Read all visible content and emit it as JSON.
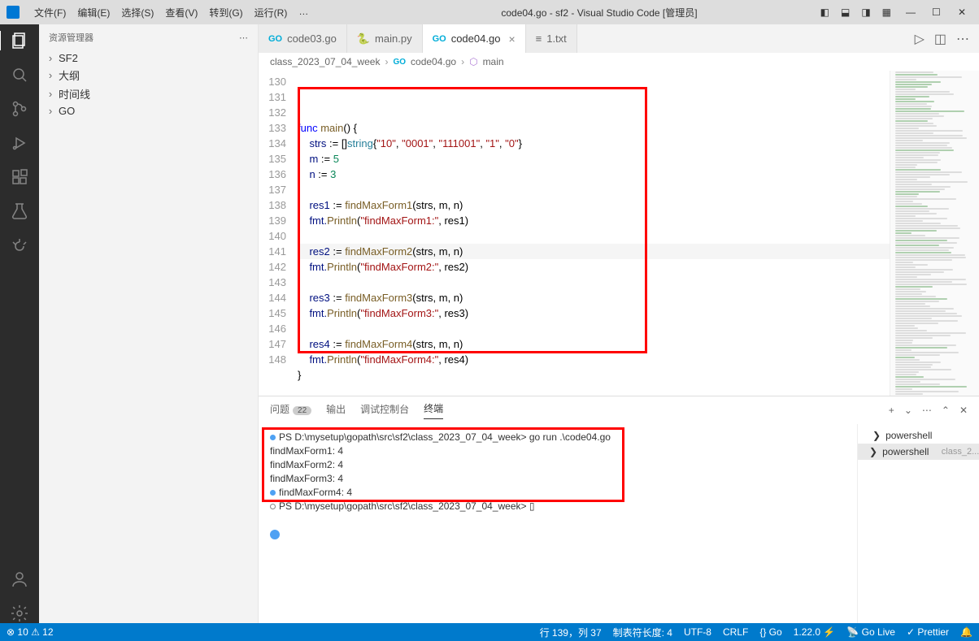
{
  "title": "code04.go - sf2 - Visual Studio Code [管理员]",
  "menu": [
    "文件(F)",
    "编辑(E)",
    "选择(S)",
    "查看(V)",
    "转到(G)",
    "运行(R)",
    "…"
  ],
  "sidebar": {
    "header": "资源管理器",
    "items": [
      "SF2",
      "大纲",
      "时间线",
      "GO"
    ]
  },
  "tabs": [
    {
      "icon": "go",
      "label": "code03.go",
      "active": false,
      "close": false
    },
    {
      "icon": "py",
      "label": "main.py",
      "active": false,
      "close": false
    },
    {
      "icon": "go",
      "label": "code04.go",
      "active": true,
      "close": true
    },
    {
      "icon": "txt",
      "label": "1.txt",
      "active": false,
      "close": false
    }
  ],
  "breadcrumbs": [
    "class_2023_07_04_week",
    "code04.go",
    "main"
  ],
  "lines": [
    130,
    131,
    132,
    133,
    134,
    135,
    136,
    137,
    138,
    139,
    140,
    141,
    142,
    143,
    144,
    145,
    146,
    147,
    148
  ],
  "code": {
    "131": [
      {
        "t": "func ",
        "c": "kw"
      },
      {
        "t": "main",
        "c": "fn"
      },
      {
        "t": "() {",
        "c": "op"
      }
    ],
    "132": [
      {
        "t": "    strs ",
        "c": "var"
      },
      {
        "t": ":= []",
        "c": "op"
      },
      {
        "t": "string",
        "c": "type"
      },
      {
        "t": "{",
        "c": "op"
      },
      {
        "t": "\"10\"",
        "c": "str"
      },
      {
        "t": ", ",
        "c": "op"
      },
      {
        "t": "\"0001\"",
        "c": "str"
      },
      {
        "t": ", ",
        "c": "op"
      },
      {
        "t": "\"111001\"",
        "c": "str"
      },
      {
        "t": ", ",
        "c": "op"
      },
      {
        "t": "\"1\"",
        "c": "str"
      },
      {
        "t": ", ",
        "c": "op"
      },
      {
        "t": "\"0\"",
        "c": "str"
      },
      {
        "t": "}",
        "c": "op"
      }
    ],
    "133": [
      {
        "t": "    m ",
        "c": "var"
      },
      {
        "t": ":= ",
        "c": "op"
      },
      {
        "t": "5",
        "c": "num"
      }
    ],
    "134": [
      {
        "t": "    n ",
        "c": "var"
      },
      {
        "t": ":= ",
        "c": "op"
      },
      {
        "t": "3",
        "c": "num"
      }
    ],
    "135": [],
    "136": [
      {
        "t": "    res1 ",
        "c": "var"
      },
      {
        "t": ":= ",
        "c": "op"
      },
      {
        "t": "findMaxForm1",
        "c": "fn"
      },
      {
        "t": "(strs, m, n)",
        "c": "op"
      }
    ],
    "137": [
      {
        "t": "    fmt.",
        "c": "var"
      },
      {
        "t": "Println",
        "c": "fn"
      },
      {
        "t": "(",
        "c": "op"
      },
      {
        "t": "\"findMaxForm1:\"",
        "c": "str"
      },
      {
        "t": ", res1)",
        "c": "op"
      }
    ],
    "138": [],
    "139": [
      {
        "t": "    res2 ",
        "c": "var"
      },
      {
        "t": ":= ",
        "c": "op"
      },
      {
        "t": "findMaxForm2",
        "c": "fn"
      },
      {
        "t": "(strs, m, n)",
        "c": "op"
      }
    ],
    "140": [
      {
        "t": "    fmt.",
        "c": "var"
      },
      {
        "t": "Println",
        "c": "fn"
      },
      {
        "t": "(",
        "c": "op"
      },
      {
        "t": "\"findMaxForm2:\"",
        "c": "str"
      },
      {
        "t": ", res2)",
        "c": "op"
      }
    ],
    "141": [],
    "142": [
      {
        "t": "    res3 ",
        "c": "var"
      },
      {
        "t": ":= ",
        "c": "op"
      },
      {
        "t": "findMaxForm3",
        "c": "fn"
      },
      {
        "t": "(strs, m, n)",
        "c": "op"
      }
    ],
    "143": [
      {
        "t": "    fmt.",
        "c": "var"
      },
      {
        "t": "Println",
        "c": "fn"
      },
      {
        "t": "(",
        "c": "op"
      },
      {
        "t": "\"findMaxForm3:\"",
        "c": "str"
      },
      {
        "t": ", res3)",
        "c": "op"
      }
    ],
    "144": [],
    "145": [
      {
        "t": "    res4 ",
        "c": "var"
      },
      {
        "t": ":= ",
        "c": "op"
      },
      {
        "t": "findMaxForm4",
        "c": "fn"
      },
      {
        "t": "(strs, m, n)",
        "c": "op"
      }
    ],
    "146": [
      {
        "t": "    fmt.",
        "c": "var"
      },
      {
        "t": "Println",
        "c": "fn"
      },
      {
        "t": "(",
        "c": "op"
      },
      {
        "t": "\"findMaxForm4:\"",
        "c": "str"
      },
      {
        "t": ", res4)",
        "c": "op"
      }
    ],
    "147": [
      {
        "t": "}",
        "c": "op"
      }
    ]
  },
  "panel": {
    "tabs": [
      {
        "label": "问题",
        "badge": "22"
      },
      {
        "label": "输出"
      },
      {
        "label": "调试控制台"
      },
      {
        "label": "终端",
        "active": true
      }
    ]
  },
  "terminal": {
    "lines": [
      {
        "dot": "blue",
        "text": "PS D:\\mysetup\\gopath\\src\\sf2\\class_2023_07_04_week> go run .\\code04.go"
      },
      {
        "dot": "",
        "text": "findMaxForm1: 4"
      },
      {
        "dot": "",
        "text": "findMaxForm2: 4"
      },
      {
        "dot": "",
        "text": "findMaxForm3: 4"
      },
      {
        "dot": "blue",
        "text": "findMaxForm4: 4"
      },
      {
        "dot": "hollow",
        "text": "PS D:\\mysetup\\gopath\\src\\sf2\\class_2023_07_04_week> ▯"
      },
      {
        "dot": "",
        "text": ""
      },
      {
        "dot": "big",
        "text": ""
      }
    ],
    "side": [
      {
        "label": "powershell",
        "active": false,
        "red": false
      },
      {
        "label": "powershell",
        "suffix": "class_2...",
        "active": true,
        "red": true
      }
    ]
  },
  "status": {
    "left": [
      "⊗ 10 ⚠ 12"
    ],
    "right": [
      "行 139，列 37",
      "制表符长度: 4",
      "UTF-8",
      "CRLF",
      "{} Go",
      "1.22.0 ⚡",
      "📡 Go Live",
      "✓ Prettier",
      "🔔"
    ]
  }
}
